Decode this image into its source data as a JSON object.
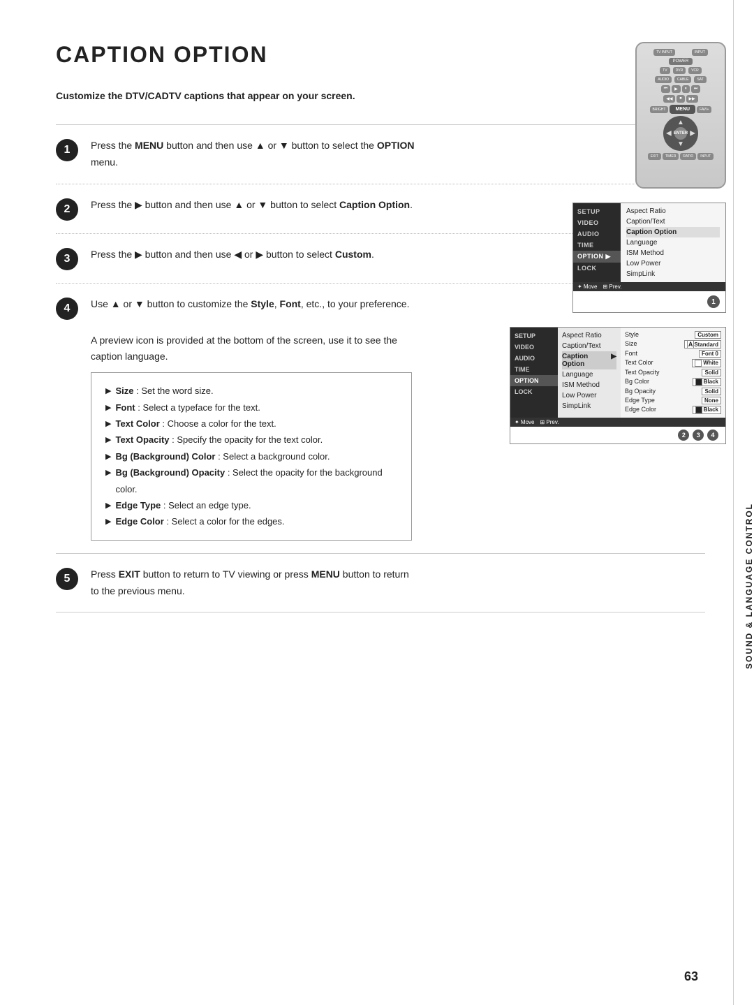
{
  "page": {
    "title": "CAPTION OPTION",
    "subtitle": "Customize the DTV/CADTV captions that appear on your screen.",
    "page_number": "63",
    "side_label": "SOUND & LANGUAGE CONTROL"
  },
  "steps": [
    {
      "num": "1",
      "text_parts": [
        {
          "type": "normal",
          "text": "Press the "
        },
        {
          "type": "bold",
          "text": "MENU"
        },
        {
          "type": "normal",
          "text": " button and then use ▲ or ▼ button to select the "
        },
        {
          "type": "bold",
          "text": "OPTION"
        },
        {
          "type": "normal",
          "text": " menu."
        }
      ]
    },
    {
      "num": "2",
      "text_parts": [
        {
          "type": "normal",
          "text": "Press the ▶ button and then use ▲ or ▼ button to select "
        },
        {
          "type": "bold",
          "text": "Caption Option"
        },
        {
          "type": "normal",
          "text": "."
        }
      ]
    },
    {
      "num": "3",
      "text_parts": [
        {
          "type": "normal",
          "text": "Press the ▶ button and then use ◀ or ▶ button to select "
        },
        {
          "type": "bold",
          "text": "Custom"
        },
        {
          "type": "normal",
          "text": "."
        }
      ]
    },
    {
      "num": "4",
      "text_parts": [
        {
          "type": "normal",
          "text": "Use ▲ or ▼ button to customize the "
        },
        {
          "type": "bold",
          "text": "Style"
        },
        {
          "type": "normal",
          "text": ", "
        },
        {
          "type": "bold",
          "text": "Font"
        },
        {
          "type": "normal",
          "text": ", etc., to your preference."
        }
      ],
      "extra": "A preview icon is provided at the bottom of the screen, use it to see the caption language."
    },
    {
      "num": "5",
      "text_parts": [
        {
          "type": "normal",
          "text": "Press "
        },
        {
          "type": "bold",
          "text": "EXIT"
        },
        {
          "type": "normal",
          "text": " button to return to TV viewing or press "
        },
        {
          "type": "bold",
          "text": "MENU"
        },
        {
          "type": "normal",
          "text": " button to return to the previous menu."
        }
      ]
    }
  ],
  "bullets": [
    {
      "bold": "Size",
      "text": ": Set the word size."
    },
    {
      "bold": "Font",
      "text": ": Select a typeface for the text."
    },
    {
      "bold": "Text Color",
      "text": ": Choose a color for the text."
    },
    {
      "bold": "Text Opacity",
      "text": ": Specify the opacity for the text color."
    },
    {
      "bold": "Bg (Background) Color",
      "text": ": Select a background color."
    },
    {
      "bold": "Bg (Background) Opacity",
      "text": ": Select the opacity for the background color."
    },
    {
      "bold": "Edge Type",
      "text": ": Select an edge type."
    },
    {
      "bold": "Edge Color",
      "text": ": Select a color for the edges."
    }
  ],
  "menu1": {
    "left_items": [
      "SETUP",
      "VIDEO",
      "AUDIO",
      "TIME",
      "OPTION",
      "LOCK"
    ],
    "active_left": "OPTION",
    "right_items": [
      "Aspect Ratio",
      "Caption/Text",
      "Caption Option",
      "Language",
      "ISM Method",
      "Low Power",
      "SimpLink"
    ],
    "selected_right": "Caption Option",
    "circle_num": "1"
  },
  "menu2": {
    "left_items": [
      "SETUP",
      "VIDEO",
      "AUDIO",
      "TIME",
      "OPTION",
      "LOCK"
    ],
    "active_left": "OPTION",
    "center_items": [
      "Aspect Ratio",
      "Caption/Text",
      "Caption Option",
      "Language",
      "ISM Method",
      "Low Power",
      "SimpLink"
    ],
    "active_center": "Caption Option",
    "right_rows": [
      {
        "label": "Style",
        "value": "Custom",
        "type": "text"
      },
      {
        "label": "Size",
        "value": "Standard",
        "type": "icon-text",
        "icon": "A"
      },
      {
        "label": "Font",
        "value": "Font 0",
        "type": "text"
      },
      {
        "label": "Text Color",
        "value": "White",
        "type": "color",
        "color": "#fff",
        "border": "#888"
      },
      {
        "label": "Text Opacity",
        "value": "Solid",
        "type": "text"
      },
      {
        "label": "Bg Color",
        "value": "Black",
        "type": "color",
        "color": "#222",
        "border": "#888"
      },
      {
        "label": "Bg Opacity",
        "value": "Solid",
        "type": "text"
      },
      {
        "label": "Edge Type",
        "value": "None",
        "type": "text"
      },
      {
        "label": "Edge Color",
        "value": "Black",
        "type": "color",
        "color": "#222",
        "border": "#888"
      }
    ],
    "circle_nums": "2 3 4"
  }
}
